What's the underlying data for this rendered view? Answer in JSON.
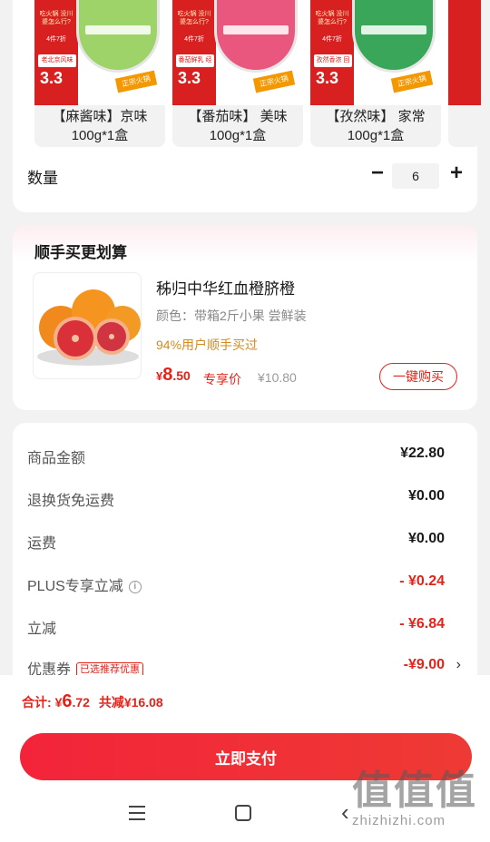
{
  "products": [
    {
      "name": "【麻酱味】京味100g*1盒",
      "promo_top": "吃火锅 没川婆怎么行?",
      "promo_badge": "4件7折",
      "promo_sub": "老北京风味 传统地道",
      "price_text": "3.3",
      "stamp": "正宗火锅",
      "cup_color": "#9ed36a"
    },
    {
      "name": "【番茄味】 美味100g*1盒",
      "promo_top": "吃火锅 没川婆怎么行?",
      "promo_badge": "4件7折",
      "promo_sub": "番茄鲜乳 经典30年",
      "price_text": "3.3",
      "stamp": "正宗火锅",
      "cup_color": "#e9577f"
    },
    {
      "name": "【孜然味】 家常100g*1盒",
      "promo_top": "吃火锅 没川婆怎么行?",
      "promo_badge": "4件7折",
      "promo_sub": "孜然香浓 回味悠长",
      "price_text": "3.3",
      "stamp": "正宗火锅",
      "cup_color": "#3aa659"
    },
    {
      "name": "",
      "promo_top": "",
      "promo_badge": "",
      "promo_sub": "",
      "price_text": "",
      "stamp": "",
      "cup_color": "#d7201f"
    }
  ],
  "quantity": {
    "label": "数量",
    "minus": "−",
    "value": "6",
    "plus": "+"
  },
  "recommend": {
    "title": "顺手买更划算",
    "product_name": "秭归中华红血橙脐橙",
    "spec": "颜色：带箱2斤小果 尝鲜装",
    "bought_pct": "94%用户顺手买过",
    "currency": "¥",
    "price_int": "8",
    "price_dec": ".50",
    "price_tag": "专享价",
    "orig_price": "¥10.80",
    "button": "一键购买"
  },
  "summary": [
    {
      "label": "商品金额",
      "value": "¥22.80",
      "red": false
    },
    {
      "label": "退换货免运费",
      "value": "¥0.00",
      "red": false
    },
    {
      "label": "运费",
      "value": "¥0.00",
      "red": false
    },
    {
      "label": "PLUS专享立减",
      "value": "- ¥0.24",
      "red": true
    },
    {
      "label": "立减",
      "value": "- ¥6.84",
      "red": true
    },
    {
      "label": "优惠券",
      "value": "-¥9.00",
      "red": true,
      "tag": "已选推荐优惠"
    }
  ],
  "info_icon": "i",
  "chevron": "›",
  "bottom": {
    "total_label": "合计:",
    "currency": "¥",
    "total_int": "6",
    "total_dec": ".72",
    "saved": "共减¥16.08",
    "pay_button": "立即支付"
  },
  "nav": {
    "back": "‹"
  },
  "watermark": {
    "glyphs": "值值值",
    "url": "zhizhizhi.com"
  },
  "colors": {
    "accent": "#e2231a",
    "orange": "#d48a1e",
    "background": "#f2f2f2"
  }
}
